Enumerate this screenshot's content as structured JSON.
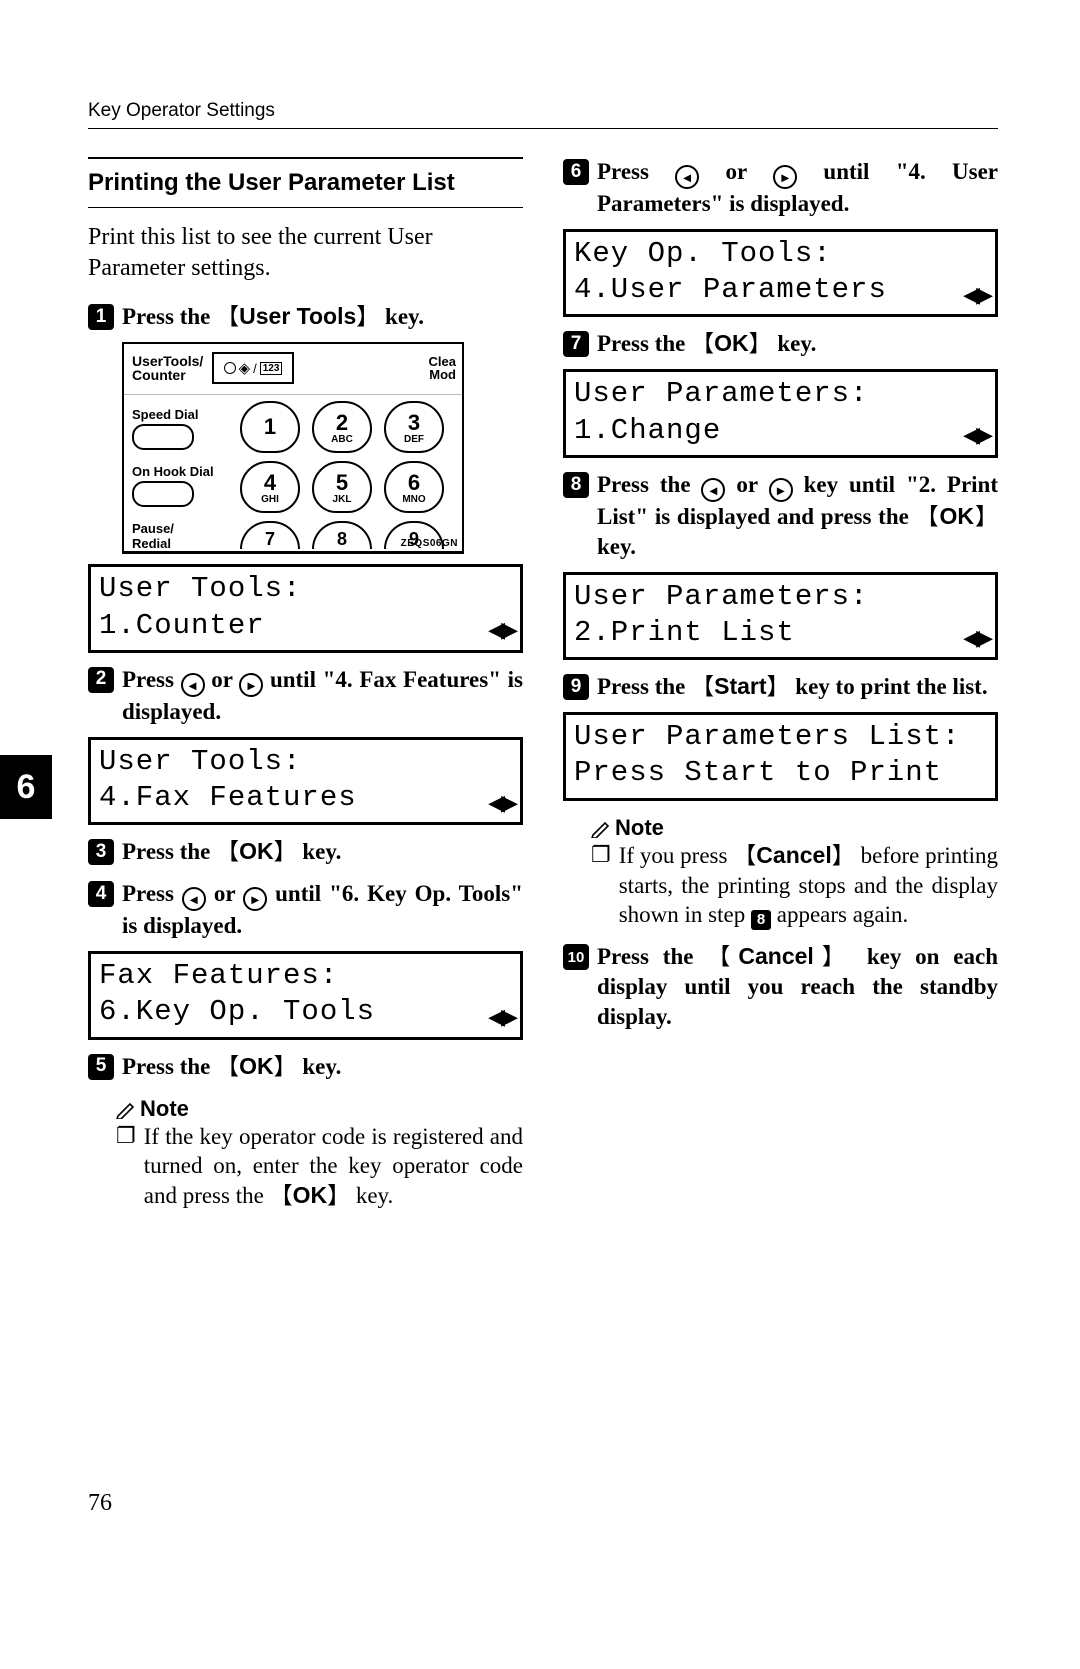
{
  "header": "Key Operator Settings",
  "chapter": "6",
  "page_number": "76",
  "section_title": "Printing the User Parameter List",
  "intro": "Print this list to see the current User Parameter settings.",
  "steps": {
    "s1_a": "Press the ",
    "s1_key": "User Tools",
    "s1_b": " key.",
    "s2_a": "Press ",
    "s2_b": " or ",
    "s2_c": " until \"4. Fax Features\" is displayed.",
    "s3_a": "Press the ",
    "s3_key": "OK",
    "s3_b": " key.",
    "s4_a": "Press ",
    "s4_b": " or ",
    "s4_c": " until \"6. Key Op. Tools\" is displayed.",
    "s5_a": "Press the ",
    "s5_key": "OK",
    "s5_b": " key.",
    "s6_a": "Press ",
    "s6_b": " or ",
    "s6_c": " until \"4. User Parameters\" is displayed.",
    "s7_a": "Press the ",
    "s7_key": "OK",
    "s7_b": " key.",
    "s8_a": "Press the ",
    "s8_b": " or ",
    "s8_c": " key until \"2. Print List\" is displayed and press the ",
    "s8_key": "OK",
    "s8_d": " key.",
    "s9_a": "Press the ",
    "s9_key": "Start",
    "s9_b": " key to print the list.",
    "s10_a": "Press the ",
    "s10_key": "Cancel",
    "s10_b": " key on each display until you reach the standby display."
  },
  "lcd": {
    "l1a": "User Tools:",
    "l1b": "1.Counter",
    "l2a": "User Tools:",
    "l2b": "4.Fax Features",
    "l3a": "Fax Features:",
    "l3b": "6.Key Op. Tools",
    "l4a": "Key Op. Tools:",
    "l4b": "4.User Parameters",
    "l5a": "User Parameters:",
    "l5b": "1.Change",
    "l6a": "User Parameters:",
    "l6b": "2.Print List",
    "l7a": "User Parameters List:",
    "l7b": "Press Start to Print"
  },
  "notes": {
    "label": "Note",
    "n1_a": "If the key operator code is registered and turned on, enter the key operator code and press the ",
    "n1_key": "OK",
    "n1_b": " key.",
    "n2_a": "If you press ",
    "n2_key": "Cancel",
    "n2_b": " before printing starts, the printing stops and the display shown in step ",
    "n2_step": "8",
    "n2_c": " appears again."
  },
  "keypad": {
    "ut_label_l1": "UserTools/",
    "ut_label_l2": "Counter",
    "clea_l1": "Clea",
    "clea_l2": "Mod",
    "speed_dial": "Speed Dial",
    "on_hook": "On Hook Dial",
    "pause": "Pause/",
    "redial": "Redial",
    "k1": "1",
    "k2": "2",
    "k3": "3",
    "k4": "4",
    "k5": "5",
    "k6": "6",
    "k7": "7",
    "k8": "8",
    "k9": "9",
    "abc": "ABC",
    "def": "DEF",
    "ghi": "GHI",
    "jkl": "JKL",
    "mno": "MNO",
    "box123": "123",
    "figid": "ZEQS06GN"
  }
}
